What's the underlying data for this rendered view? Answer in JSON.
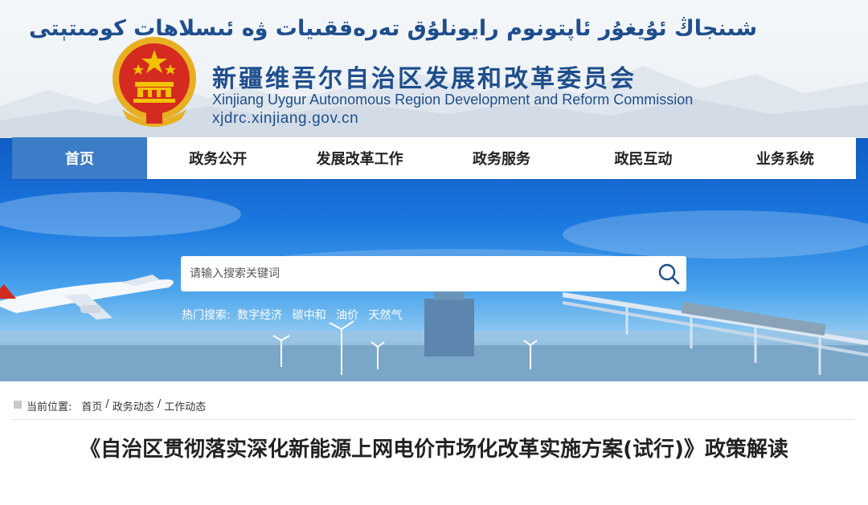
{
  "header": {
    "title_ug": "شىنجاڭ ئۇيغۇر ئاپتونوم رايونلۇق تەرەققىيات ۋە ئىسلاھات كومىتېتى",
    "title_cn": "新疆维吾尔自治区发展和改革委员会",
    "title_en": "Xinjiang Uygur Autonomous Region Development and Reform Commission",
    "domain": "xjdrc.xinjiang.gov.cn",
    "emblem_icon": "national-emblem"
  },
  "nav": {
    "items": [
      "首页",
      "政务公开",
      "发展改革工作",
      "政务服务",
      "政民互动",
      "业务系统"
    ],
    "active_index": 0,
    "active_color": "#3d7dc7"
  },
  "search": {
    "placeholder": "请输入搜索关键词",
    "icon": "search-icon",
    "hot_label": "热门搜索:",
    "hot_terms": [
      "数字经济",
      "碳中和",
      "油价",
      "天然气"
    ]
  },
  "breadcrumb": {
    "label": "当前位置:",
    "items": [
      "首页",
      "政务动态",
      "工作动态"
    ],
    "separator": "/"
  },
  "article": {
    "title": "《自治区贯彻落实深化新能源上网电价市场化改革实施方案(试行)》政策解读"
  },
  "colors": {
    "brand_blue": "#1f4e8c",
    "banner_blue": "#1a78df"
  }
}
